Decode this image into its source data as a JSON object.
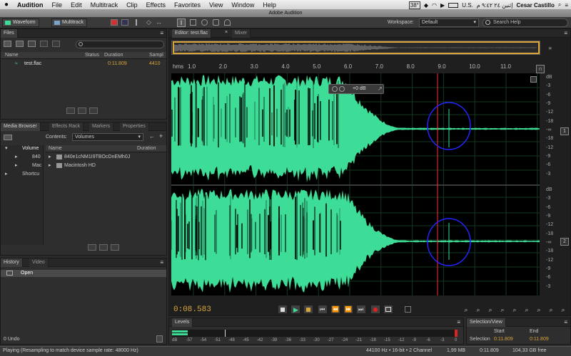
{
  "menubar": {
    "apple": "",
    "app": "Audition",
    "items": [
      "File",
      "Edit",
      "Multitrack",
      "Clip",
      "Effects",
      "Favorites",
      "View",
      "Window",
      "Help"
    ],
    "right": {
      "cpu": "38°",
      "lang": "U.S.",
      "clock": "إثنين ٢٤ ٩:٤٢ م",
      "user": "Cesar Castillo"
    }
  },
  "titlebar": {
    "title": "Adobe Audition"
  },
  "toolbar": {
    "waveform_label": "Waveform",
    "multitrack_label": "Multitrack",
    "workspace_label": "Workspace:",
    "workspace_value": "Default",
    "search_placeholder": "Search Help"
  },
  "files_panel": {
    "tab": "Files",
    "search_placeholder": "",
    "columns": [
      "Name",
      "Status",
      "Duration",
      "Sampl"
    ],
    "rows": [
      {
        "name": "test.flac",
        "status": "",
        "duration": "0:11.809",
        "sample": "4410"
      }
    ]
  },
  "media_panel": {
    "tabs": [
      "Media Browser",
      "Effects Rack",
      "Markers",
      "Properties"
    ],
    "contents_label": "Contents:",
    "contents_value": "Volumes",
    "tree": [
      "Volume",
      "840",
      "Mac",
      "Shortcu"
    ],
    "columns": [
      "Name",
      "Duration"
    ],
    "rows": [
      "840e1cNM1I9TBOcDnEMh0J",
      "Macintosh HD"
    ]
  },
  "history_panel": {
    "tabs": [
      "History",
      "Video"
    ],
    "rows": [
      "Open"
    ],
    "undo": "0 Undo"
  },
  "editor": {
    "tabs": [
      "Editor: test.flac",
      "Mixer"
    ],
    "ruler_unit": "hms",
    "ruler": [
      "1.0",
      "2.0",
      "3.0",
      "4.0",
      "5.0",
      "6.0",
      "7.0",
      "8.0",
      "9.0",
      "10.0",
      "11.0"
    ],
    "db_top": [
      "dB",
      "-3",
      "-6",
      "-9",
      "-12",
      "-18",
      "-∞",
      "-18",
      "-12",
      "-9",
      "-6",
      "-3"
    ],
    "db_bottom": [
      "dB",
      "-3",
      "-6",
      "-9",
      "-12",
      "-18",
      "-∞",
      "-18",
      "-12",
      "-9",
      "-6",
      "-3"
    ],
    "channel_top": "1",
    "channel_bottom": "2",
    "hud_gain": "+0 dB",
    "current_time": "0:08.583"
  },
  "levels_panel": {
    "tab": "Levels",
    "scale": [
      "dB",
      "-57",
      "-54",
      "-51",
      "-48",
      "-45",
      "-42",
      "-39",
      "-36",
      "-33",
      "-30",
      "-27",
      "-24",
      "-21",
      "-18",
      "-15",
      "-12",
      "-9",
      "-6",
      "-3",
      "0"
    ]
  },
  "selection_panel": {
    "tab": "Selection/View",
    "start_label": "Start",
    "end_label": "End",
    "row_label": "Selection",
    "start": "0:11.809",
    "end": "0:11.809"
  },
  "status": {
    "message": "Playing (Resampling to match device sample rate: 48000 Hz)",
    "format": "44100 Hz • 16-bit • 2 Channel",
    "size": "1,99 MB",
    "duration": "0:11.809",
    "free": "104,33 GB free"
  },
  "colors": {
    "waveform": "#3ddc97",
    "playhead": "#ff3030",
    "annotation": "#2424ff",
    "time": "#d9a53a"
  }
}
